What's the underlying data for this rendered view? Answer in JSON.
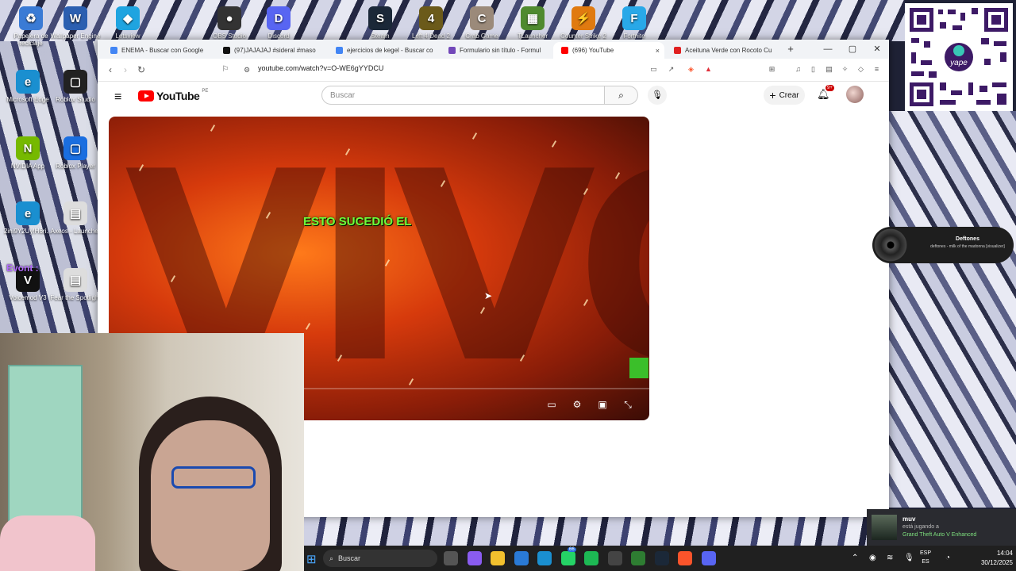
{
  "desktop": {
    "icons": [
      {
        "label": "Papelera de reciclaje",
        "glyph": "♻",
        "color": "#3a7bd5"
      },
      {
        "label": "Wallpaper Engine",
        "glyph": "W",
        "color": "#2b5fb0"
      },
      {
        "label": "Letsview",
        "glyph": "◆",
        "color": "#1fa4e0"
      },
      {
        "label": "OBS Studio",
        "glyph": "●",
        "color": "#333333"
      },
      {
        "label": "Discord",
        "glyph": "D",
        "color": "#5865f2"
      },
      {
        "label": "Steam",
        "glyph": "S",
        "color": "#1b2838"
      },
      {
        "label": "Left 4 Dead 2",
        "glyph": "4",
        "color": "#6b5a1a"
      },
      {
        "label": "Crab Game",
        "glyph": "C",
        "color": "#9b8a7a"
      },
      {
        "label": "TLauncher",
        "glyph": "▦",
        "color": "#4f8a2f"
      },
      {
        "label": "Counter Strike 2",
        "glyph": "⚡",
        "color": "#e07a10"
      },
      {
        "label": "Fortnite",
        "glyph": "F",
        "color": "#29a8e8"
      },
      {
        "label": "Microsoft Edge",
        "glyph": "e",
        "color": "#1a8fd0"
      },
      {
        "label": "Roblox Studio",
        "glyph": "▢",
        "color": "#222222"
      },
      {
        "label": "NVIDIA App",
        "glyph": "N",
        "color": "#76b900"
      },
      {
        "label": "Roblox Player",
        "glyph": "▢",
        "color": "#1a6ee0"
      },
      {
        "label": "2ini9Y2Uy!H6ri...",
        "glyph": "e",
        "color": "#1a8fd0"
      },
      {
        "label": "Axeos - Launcher",
        "glyph": "▤",
        "color": "#dddddd"
      },
      {
        "label": "Voicemod V3",
        "glyph": "V",
        "color": "#111111"
      },
      {
        "label": "Fear the Spotlight",
        "glyph": "▤",
        "color": "#dddddd"
      }
    ],
    "overlay_text": "Evont :"
  },
  "browser": {
    "tabs": [
      {
        "title": "ENEMA - Buscar con Google",
        "fav": "#4285f4"
      },
      {
        "title": "(97)JAJAJAJ #sideral #maso",
        "fav": "#111111"
      },
      {
        "title": "ejercicios de kegel - Buscar co",
        "fav": "#4285f4"
      },
      {
        "title": "Formulario sin título - Formul",
        "fav": "#7248b9"
      },
      {
        "title": "(696) YouTube",
        "fav": "#ff0000"
      },
      {
        "title": "Aceituna Verde con Rocoto Cu",
        "fav": "#e02020"
      }
    ],
    "active_close": "×",
    "new_tab": "+",
    "url": "youtube.com/watch?v=O-WE6gYYDCU",
    "window_controls": [
      "—",
      "▢",
      "✕"
    ]
  },
  "youtube": {
    "menu_icon": "≡",
    "logo_text": "YouTube",
    "country_code": "PE",
    "search_placeholder": "Buscar",
    "create_label": "Crear",
    "notifications_badge": "9+",
    "video": {
      "big_text": "VIVO",
      "overlay_text": "ESTO SUCEDIÓ EL",
      "controls": [
        "▭",
        "⚙",
        "▣",
        "⤡"
      ]
    }
  },
  "music_widget": {
    "artist": "Deftones",
    "track": "deftones - milk of the madonna [visualizer]"
  },
  "discord_popup": {
    "name": "muv",
    "status": "está jugando a",
    "game": "Grand Theft Auto V Enhanced"
  },
  "taskbar": {
    "search_label": "Buscar",
    "lang_1": "ESP",
    "lang_2": "ES",
    "time": "14:04",
    "date": "30/12/2025",
    "whatsapp_badge": "66",
    "apps": [
      {
        "name": "task-view-icon",
        "color": "#555555"
      },
      {
        "name": "copilot-icon",
        "color": "#8a5cf0"
      },
      {
        "name": "file-explorer-icon",
        "color": "#f2c12e"
      },
      {
        "name": "store-icon",
        "color": "#2a7ad6"
      },
      {
        "name": "edge-icon",
        "color": "#1a8fd0"
      },
      {
        "name": "whatsapp-icon",
        "color": "#25d366"
      },
      {
        "name": "spotify-icon",
        "color": "#1db954"
      },
      {
        "name": "obs-icon",
        "color": "#444444"
      },
      {
        "name": "xbox-icon",
        "color": "#2e7d32"
      },
      {
        "name": "steam-icon",
        "color": "#1b2838"
      },
      {
        "name": "brave-icon",
        "color": "#fb542b"
      },
      {
        "name": "discord-icon",
        "color": "#5865f2"
      }
    ]
  }
}
